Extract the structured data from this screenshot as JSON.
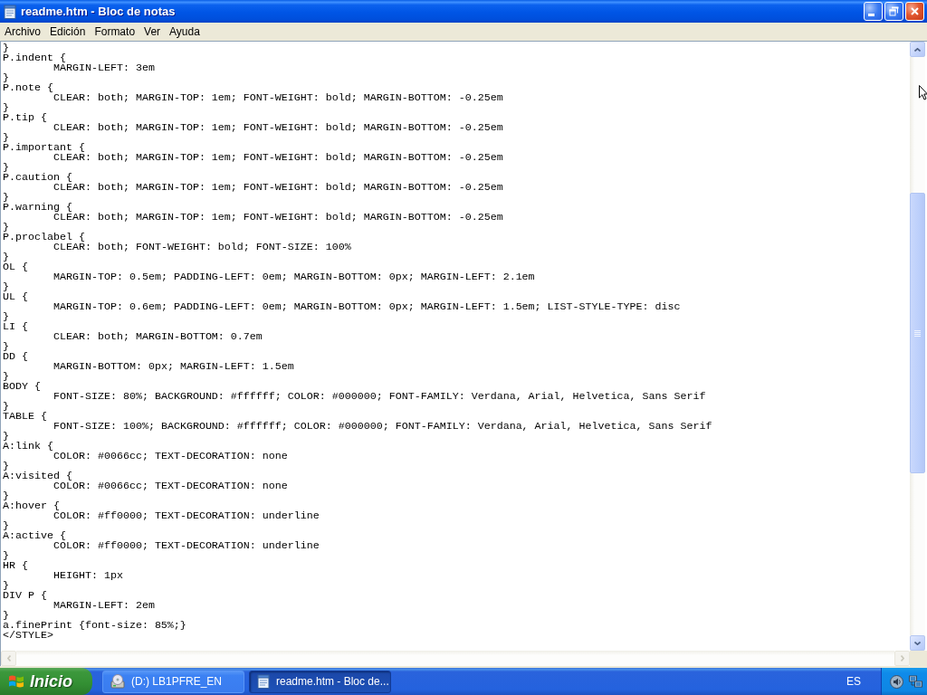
{
  "window": {
    "title": "readme.htm - Bloc de notas"
  },
  "menu": [
    "Archivo",
    "Edición",
    "Formato",
    "Ver",
    "Ayuda"
  ],
  "editor": {
    "lines": [
      {
        "text": "}"
      },
      {
        "text": "P.indent {",
        "children": [
          {
            "text": "MARGIN-LEFT: 3em"
          }
        ]
      },
      {
        "text": "}"
      },
      {
        "text": "P.note {",
        "children": [
          {
            "text": "CLEAR: both; MARGIN-TOP: 1em; FONT-WEIGHT: bold; MARGIN-BOTTOM: -0.25em"
          }
        ]
      },
      {
        "text": "}"
      },
      {
        "text": "P.tip {",
        "children": [
          {
            "text": "CLEAR: both; MARGIN-TOP: 1em; FONT-WEIGHT: bold; MARGIN-BOTTOM: -0.25em"
          }
        ]
      },
      {
        "text": "}"
      },
      {
        "text": "P.important {",
        "children": [
          {
            "text": "CLEAR: both; MARGIN-TOP: 1em; FONT-WEIGHT: bold; MARGIN-BOTTOM: -0.25em"
          }
        ]
      },
      {
        "text": "}"
      },
      {
        "text": "P.caution {",
        "children": [
          {
            "text": "CLEAR: both; MARGIN-TOP: 1em; FONT-WEIGHT: bold; MARGIN-BOTTOM: -0.25em"
          }
        ]
      },
      {
        "text": "}"
      },
      {
        "text": "P.warning {",
        "children": [
          {
            "text": "CLEAR: both; MARGIN-TOP: 1em; FONT-WEIGHT: bold; MARGIN-BOTTOM: -0.25em"
          }
        ]
      },
      {
        "text": "}"
      },
      {
        "text": "P.proclabel {",
        "children": [
          {
            "text": "CLEAR: both; FONT-WEIGHT: bold; FONT-SIZE: 100%"
          }
        ]
      },
      {
        "text": "}"
      },
      {
        "text": "OL {",
        "children": [
          {
            "text": "MARGIN-TOP: 0.5em; PADDING-LEFT: 0em; MARGIN-BOTTOM: 0px; MARGIN-LEFT: 2.1em"
          }
        ]
      },
      {
        "text": "}"
      },
      {
        "text": "UL {",
        "children": [
          {
            "text": "MARGIN-TOP: 0.6em; PADDING-LEFT: 0em; MARGIN-BOTTOM: 0px; MARGIN-LEFT: 1.5em; LIST-STYLE-TYPE: disc"
          }
        ]
      },
      {
        "text": "}"
      },
      {
        "text": "LI {",
        "children": [
          {
            "text": "CLEAR: both; MARGIN-BOTTOM: 0.7em"
          }
        ]
      },
      {
        "text": "}"
      },
      {
        "text": "DD {",
        "children": [
          {
            "text": "MARGIN-BOTTOM: 0px; MARGIN-LEFT: 1.5em"
          }
        ]
      },
      {
        "text": "}"
      },
      {
        "text": "BODY {",
        "children": [
          {
            "text": "FONT-SIZE: 80%; BACKGROUND: #ffffff; COLOR: #000000; FONT-FAMILY: Verdana, Arial, Helvetica, Sans Serif"
          }
        ]
      },
      {
        "text": "}"
      },
      {
        "text": "TABLE {",
        "children": [
          {
            "text": "FONT-SIZE: 100%; BACKGROUND: #ffffff; COLOR: #000000; FONT-FAMILY: Verdana, Arial, Helvetica, Sans Serif"
          }
        ]
      },
      {
        "text": "}"
      },
      {
        "text": "A:link {",
        "children": [
          {
            "text": "COLOR: #0066cc; TEXT-DECORATION: none"
          }
        ]
      },
      {
        "text": "}"
      },
      {
        "text": "A:visited {",
        "children": [
          {
            "text": "COLOR: #0066cc; TEXT-DECORATION: none"
          }
        ]
      },
      {
        "text": "}"
      },
      {
        "text": "A:hover {",
        "children": [
          {
            "text": "COLOR: #ff0000; TEXT-DECORATION: underline"
          }
        ]
      },
      {
        "text": "}"
      },
      {
        "text": "A:active {",
        "children": [
          {
            "text": "COLOR: #ff0000; TEXT-DECORATION: underline"
          }
        ]
      },
      {
        "text": "}"
      },
      {
        "text": "HR {",
        "children": [
          {
            "text": "HEIGHT: 1px"
          }
        ]
      },
      {
        "text": "}"
      },
      {
        "text": "DIV P {",
        "children": [
          {
            "text": "MARGIN-LEFT: 2em"
          }
        ]
      },
      {
        "text": "}"
      },
      {
        "text": "a.finePrint {font-size: 85%;}"
      },
      {
        "text": "</STYLE>"
      }
    ]
  },
  "taskbar": {
    "start": "Inicio",
    "tasks": [
      {
        "label": "(D:) LB1PFRE_EN",
        "selected": false,
        "kind": "drive"
      },
      {
        "label": "readme.htm - Bloc de...",
        "selected": true,
        "kind": "notepad"
      }
    ],
    "language": "ES"
  }
}
